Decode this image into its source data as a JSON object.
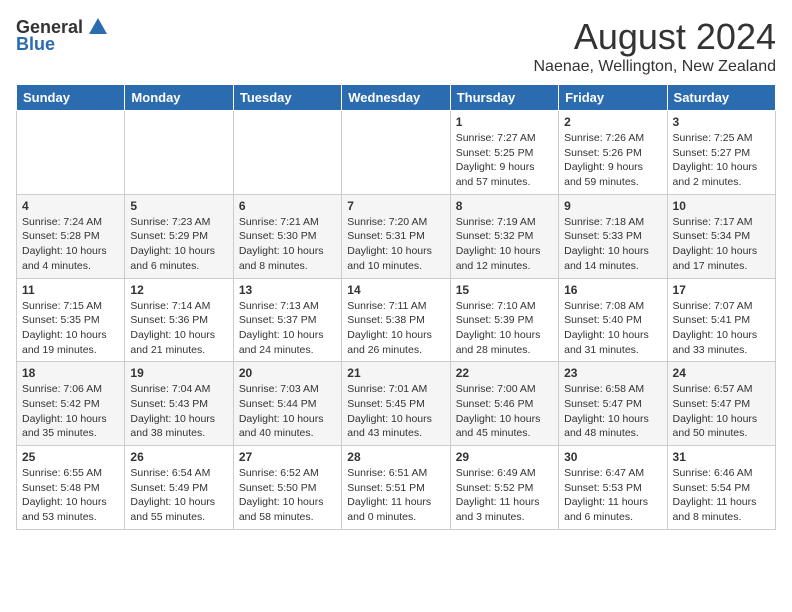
{
  "logo": {
    "general": "General",
    "blue": "Blue"
  },
  "title": "August 2024",
  "location": "Naenae, Wellington, New Zealand",
  "days_of_week": [
    "Sunday",
    "Monday",
    "Tuesday",
    "Wednesday",
    "Thursday",
    "Friday",
    "Saturday"
  ],
  "weeks": [
    [
      {
        "day": "",
        "sunrise": "",
        "sunset": "",
        "daylight": ""
      },
      {
        "day": "",
        "sunrise": "",
        "sunset": "",
        "daylight": ""
      },
      {
        "day": "",
        "sunrise": "",
        "sunset": "",
        "daylight": ""
      },
      {
        "day": "",
        "sunrise": "",
        "sunset": "",
        "daylight": ""
      },
      {
        "day": "1",
        "sunrise": "Sunrise: 7:27 AM",
        "sunset": "Sunset: 5:25 PM",
        "daylight": "Daylight: 9 hours and 57 minutes."
      },
      {
        "day": "2",
        "sunrise": "Sunrise: 7:26 AM",
        "sunset": "Sunset: 5:26 PM",
        "daylight": "Daylight: 9 hours and 59 minutes."
      },
      {
        "day": "3",
        "sunrise": "Sunrise: 7:25 AM",
        "sunset": "Sunset: 5:27 PM",
        "daylight": "Daylight: 10 hours and 2 minutes."
      }
    ],
    [
      {
        "day": "4",
        "sunrise": "Sunrise: 7:24 AM",
        "sunset": "Sunset: 5:28 PM",
        "daylight": "Daylight: 10 hours and 4 minutes."
      },
      {
        "day": "5",
        "sunrise": "Sunrise: 7:23 AM",
        "sunset": "Sunset: 5:29 PM",
        "daylight": "Daylight: 10 hours and 6 minutes."
      },
      {
        "day": "6",
        "sunrise": "Sunrise: 7:21 AM",
        "sunset": "Sunset: 5:30 PM",
        "daylight": "Daylight: 10 hours and 8 minutes."
      },
      {
        "day": "7",
        "sunrise": "Sunrise: 7:20 AM",
        "sunset": "Sunset: 5:31 PM",
        "daylight": "Daylight: 10 hours and 10 minutes."
      },
      {
        "day": "8",
        "sunrise": "Sunrise: 7:19 AM",
        "sunset": "Sunset: 5:32 PM",
        "daylight": "Daylight: 10 hours and 12 minutes."
      },
      {
        "day": "9",
        "sunrise": "Sunrise: 7:18 AM",
        "sunset": "Sunset: 5:33 PM",
        "daylight": "Daylight: 10 hours and 14 minutes."
      },
      {
        "day": "10",
        "sunrise": "Sunrise: 7:17 AM",
        "sunset": "Sunset: 5:34 PM",
        "daylight": "Daylight: 10 hours and 17 minutes."
      }
    ],
    [
      {
        "day": "11",
        "sunrise": "Sunrise: 7:15 AM",
        "sunset": "Sunset: 5:35 PM",
        "daylight": "Daylight: 10 hours and 19 minutes."
      },
      {
        "day": "12",
        "sunrise": "Sunrise: 7:14 AM",
        "sunset": "Sunset: 5:36 PM",
        "daylight": "Daylight: 10 hours and 21 minutes."
      },
      {
        "day": "13",
        "sunrise": "Sunrise: 7:13 AM",
        "sunset": "Sunset: 5:37 PM",
        "daylight": "Daylight: 10 hours and 24 minutes."
      },
      {
        "day": "14",
        "sunrise": "Sunrise: 7:11 AM",
        "sunset": "Sunset: 5:38 PM",
        "daylight": "Daylight: 10 hours and 26 minutes."
      },
      {
        "day": "15",
        "sunrise": "Sunrise: 7:10 AM",
        "sunset": "Sunset: 5:39 PM",
        "daylight": "Daylight: 10 hours and 28 minutes."
      },
      {
        "day": "16",
        "sunrise": "Sunrise: 7:08 AM",
        "sunset": "Sunset: 5:40 PM",
        "daylight": "Daylight: 10 hours and 31 minutes."
      },
      {
        "day": "17",
        "sunrise": "Sunrise: 7:07 AM",
        "sunset": "Sunset: 5:41 PM",
        "daylight": "Daylight: 10 hours and 33 minutes."
      }
    ],
    [
      {
        "day": "18",
        "sunrise": "Sunrise: 7:06 AM",
        "sunset": "Sunset: 5:42 PM",
        "daylight": "Daylight: 10 hours and 35 minutes."
      },
      {
        "day": "19",
        "sunrise": "Sunrise: 7:04 AM",
        "sunset": "Sunset: 5:43 PM",
        "daylight": "Daylight: 10 hours and 38 minutes."
      },
      {
        "day": "20",
        "sunrise": "Sunrise: 7:03 AM",
        "sunset": "Sunset: 5:44 PM",
        "daylight": "Daylight: 10 hours and 40 minutes."
      },
      {
        "day": "21",
        "sunrise": "Sunrise: 7:01 AM",
        "sunset": "Sunset: 5:45 PM",
        "daylight": "Daylight: 10 hours and 43 minutes."
      },
      {
        "day": "22",
        "sunrise": "Sunrise: 7:00 AM",
        "sunset": "Sunset: 5:46 PM",
        "daylight": "Daylight: 10 hours and 45 minutes."
      },
      {
        "day": "23",
        "sunrise": "Sunrise: 6:58 AM",
        "sunset": "Sunset: 5:47 PM",
        "daylight": "Daylight: 10 hours and 48 minutes."
      },
      {
        "day": "24",
        "sunrise": "Sunrise: 6:57 AM",
        "sunset": "Sunset: 5:47 PM",
        "daylight": "Daylight: 10 hours and 50 minutes."
      }
    ],
    [
      {
        "day": "25",
        "sunrise": "Sunrise: 6:55 AM",
        "sunset": "Sunset: 5:48 PM",
        "daylight": "Daylight: 10 hours and 53 minutes."
      },
      {
        "day": "26",
        "sunrise": "Sunrise: 6:54 AM",
        "sunset": "Sunset: 5:49 PM",
        "daylight": "Daylight: 10 hours and 55 minutes."
      },
      {
        "day": "27",
        "sunrise": "Sunrise: 6:52 AM",
        "sunset": "Sunset: 5:50 PM",
        "daylight": "Daylight: 10 hours and 58 minutes."
      },
      {
        "day": "28",
        "sunrise": "Sunrise: 6:51 AM",
        "sunset": "Sunset: 5:51 PM",
        "daylight": "Daylight: 11 hours and 0 minutes."
      },
      {
        "day": "29",
        "sunrise": "Sunrise: 6:49 AM",
        "sunset": "Sunset: 5:52 PM",
        "daylight": "Daylight: 11 hours and 3 minutes."
      },
      {
        "day": "30",
        "sunrise": "Sunrise: 6:47 AM",
        "sunset": "Sunset: 5:53 PM",
        "daylight": "Daylight: 11 hours and 6 minutes."
      },
      {
        "day": "31",
        "sunrise": "Sunrise: 6:46 AM",
        "sunset": "Sunset: 5:54 PM",
        "daylight": "Daylight: 11 hours and 8 minutes."
      }
    ]
  ]
}
